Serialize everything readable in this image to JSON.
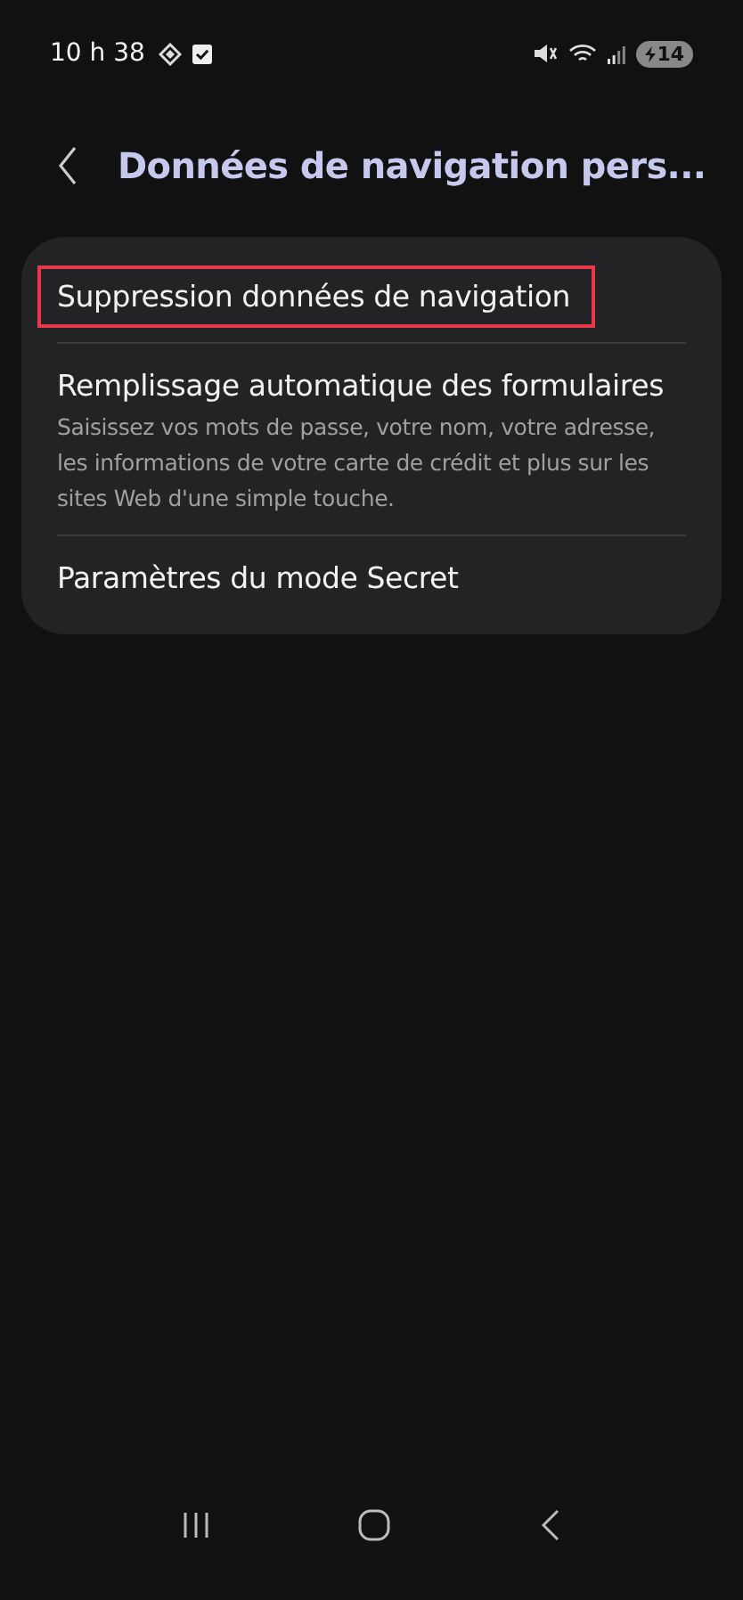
{
  "status_bar": {
    "time": "10 h 38",
    "battery": "14"
  },
  "header": {
    "title": "Données de navigation pers..."
  },
  "items": [
    {
      "title": "Suppression données de navigation",
      "highlighted": true
    },
    {
      "title": "Remplissage automatique des formulaires",
      "description": "Saisissez vos mots de passe, votre nom, votre adresse, les informations de votre carte de crédit et plus sur les sites Web d'une simple touche.",
      "highlighted": false
    },
    {
      "title": "Paramètres du mode Secret",
      "highlighted": false
    }
  ]
}
